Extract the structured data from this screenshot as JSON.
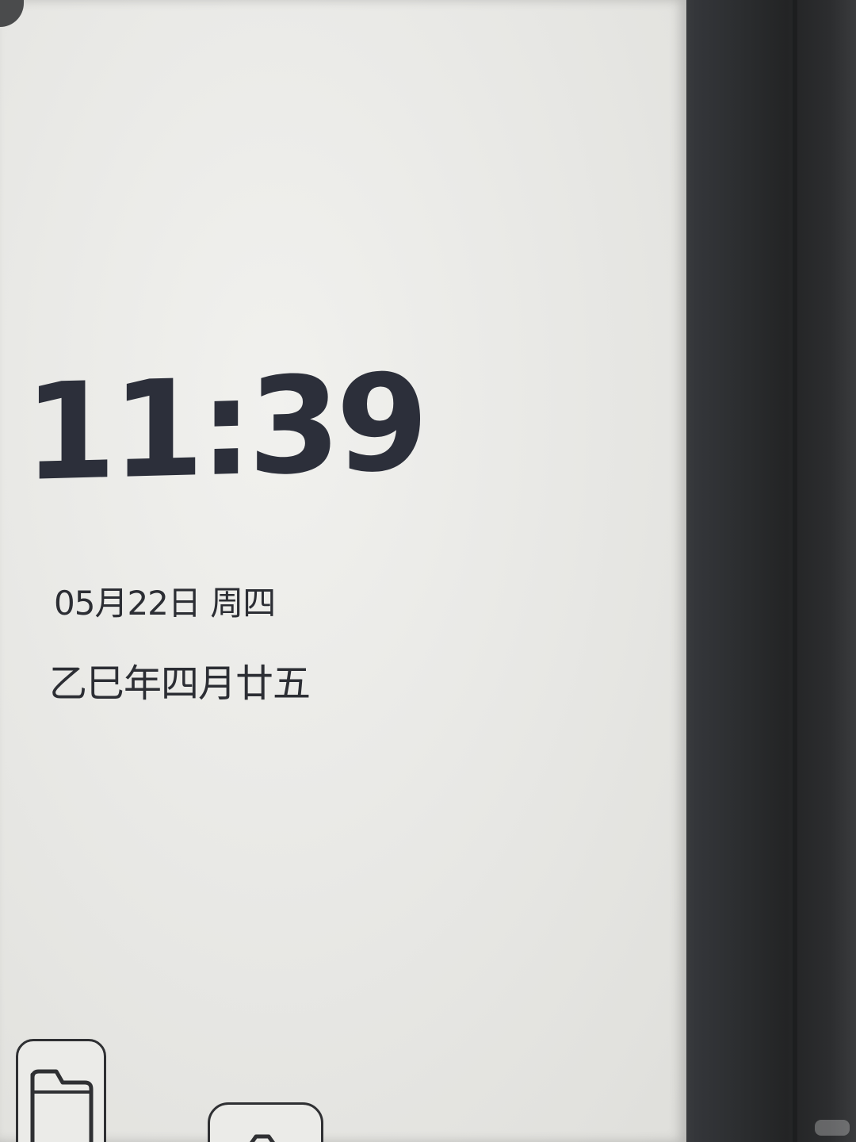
{
  "lockscreen": {
    "time": "11:39",
    "date": "05月22日 周四",
    "lunar_date": "乙巳年四月廿五"
  },
  "dock": {
    "icons": [
      {
        "name": "folder-icon"
      },
      {
        "name": "app-icon"
      }
    ]
  },
  "colors": {
    "screen": "#e9e9e6",
    "ink": "#2c2f3a",
    "bezel": "#2b2d2f"
  }
}
